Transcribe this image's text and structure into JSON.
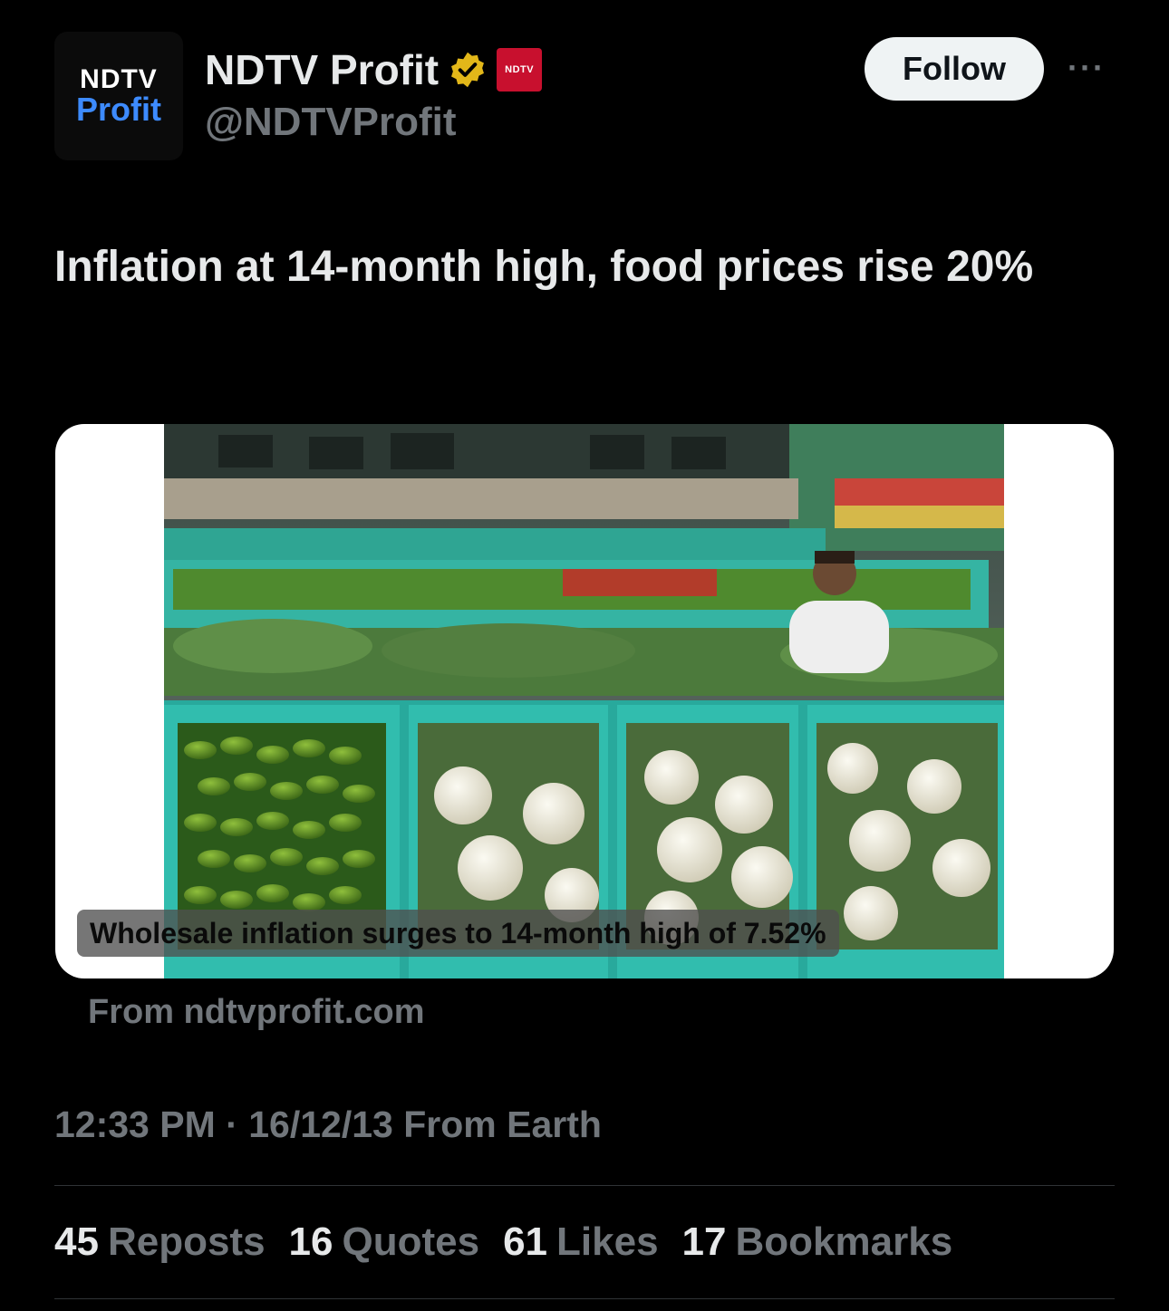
{
  "account": {
    "avatar_line1": "NDTV",
    "avatar_line2": "Profit",
    "display_name": "NDTV Profit",
    "affiliate_badge": "NDTV",
    "handle": "@NDTVProfit"
  },
  "actions": {
    "follow_label": "Follow",
    "more_label": "···"
  },
  "tweet": {
    "text": "Inflation at 14-month high, food prices rise 20%"
  },
  "card": {
    "caption": "Wholesale inflation surges to 14-month high of 7.52%",
    "source": "From ndtvprofit.com"
  },
  "meta": {
    "time": "12:33 PM",
    "separator": "·",
    "date": "16/12/13",
    "via": "From Earth"
  },
  "stats": [
    {
      "count": "45",
      "label": "Reposts"
    },
    {
      "count": "16",
      "label": "Quotes"
    },
    {
      "count": "61",
      "label": "Likes"
    },
    {
      "count": "17",
      "label": "Bookmarks"
    }
  ],
  "colors": {
    "background": "#000000",
    "primary_text": "#e7e9ea",
    "secondary_text": "#71767b",
    "verified_gold": "#e2b719",
    "brand_red": "#c8102e",
    "crate_teal": "#2fb3a5"
  },
  "icons": {
    "verified": "verified-gold-badge-icon",
    "affiliate": "ndtv-affiliate-badge-icon",
    "more": "more-dots-icon"
  }
}
